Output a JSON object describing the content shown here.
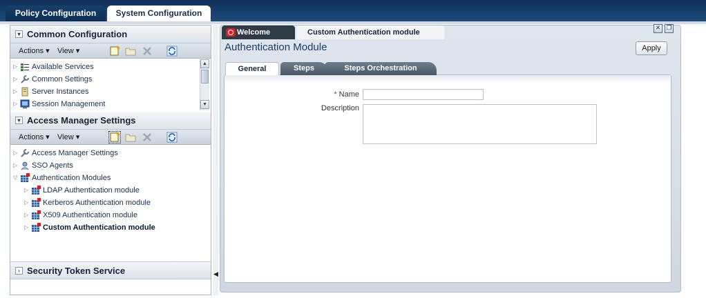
{
  "top_tabs": [
    {
      "label": "Policy Configuration"
    },
    {
      "label": "System Configuration"
    }
  ],
  "left_panel": {
    "common_configuration": {
      "title": "Common Configuration",
      "toolbar": {
        "actions": "Actions",
        "view": "View"
      },
      "items": [
        {
          "label": "Available Services",
          "icon": "services-icon"
        },
        {
          "label": "Common Settings",
          "icon": "wrench-icon"
        },
        {
          "label": "Server Instances",
          "icon": "server-icon"
        },
        {
          "label": "Session Management",
          "icon": "monitor-icon"
        }
      ]
    },
    "access_manager_settings": {
      "title": "Access Manager Settings",
      "toolbar": {
        "actions": "Actions",
        "view": "View"
      },
      "items": [
        {
          "label": "Access Manager Settings",
          "icon": "wrench-icon",
          "level": 0
        },
        {
          "label": "SSO Agents",
          "icon": "agent-icon",
          "level": 0
        },
        {
          "label": "Authentication Modules",
          "icon": "module-icon",
          "level": 0,
          "expanded": true
        },
        {
          "label": "LDAP Authentication module",
          "icon": "module-icon",
          "level": 1
        },
        {
          "label": "Kerberos Authentication module",
          "icon": "module-icon",
          "level": 1
        },
        {
          "label": "X509 Authentication module",
          "icon": "module-icon",
          "level": 1
        },
        {
          "label": "Custom Authentication module",
          "icon": "module-icon",
          "level": 1,
          "selected": true
        }
      ]
    },
    "security_token_service": {
      "title": "Security Token Service"
    }
  },
  "document_tabs": [
    {
      "label": "Welcome"
    },
    {
      "label": "Custom Authentication module"
    }
  ],
  "panel": {
    "title": "Authentication Module",
    "apply_label": "Apply",
    "sub_tabs": [
      {
        "label": "General"
      },
      {
        "label": "Steps"
      },
      {
        "label": "Steps Orchestration"
      }
    ],
    "form": {
      "name_required_marker": "*",
      "name_label": "Name",
      "name_value": "",
      "description_label": "Description",
      "description_value": ""
    }
  },
  "colors": {
    "header_dark": "#10305a",
    "title_blue": "#1b3b6b",
    "oracle_red": "#d4202b"
  }
}
